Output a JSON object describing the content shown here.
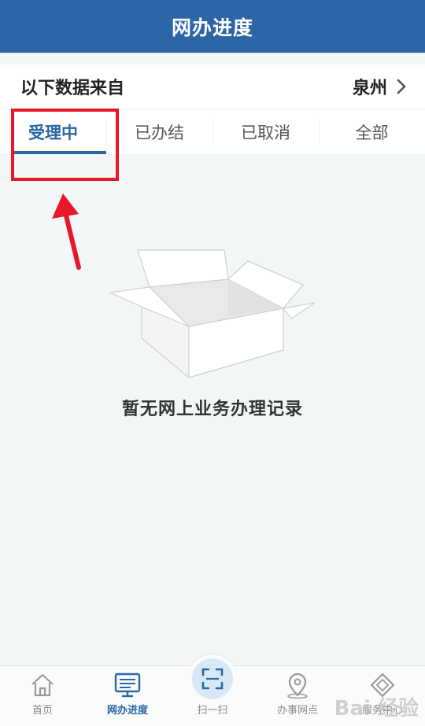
{
  "header": {
    "title": "网办进度"
  },
  "source": {
    "label": "以下数据来自",
    "city": "泉州"
  },
  "tabs": [
    {
      "label": "受理中",
      "active": true
    },
    {
      "label": "已办结",
      "active": false
    },
    {
      "label": "已取消",
      "active": false
    },
    {
      "label": "全部",
      "active": false
    }
  ],
  "empty_state": {
    "message": "暂无网上业务办理记录",
    "icon": "empty-box-icon"
  },
  "bottom_nav": [
    {
      "label": "首页",
      "icon": "home-icon"
    },
    {
      "label": "网办进度",
      "icon": "progress-monitor-icon",
      "active": true
    },
    {
      "label": "扫一扫",
      "icon": "scan-icon"
    },
    {
      "label": "办事网点",
      "icon": "location-pin-icon"
    },
    {
      "label": "服务中心",
      "icon": "service-diamond-icon"
    }
  ],
  "annotations": {
    "highlight_color": "#e6192a"
  },
  "watermark": {
    "text": "Bai 经验"
  },
  "colors": {
    "brand": "#2c66a6",
    "background": "#f2f6f7"
  }
}
